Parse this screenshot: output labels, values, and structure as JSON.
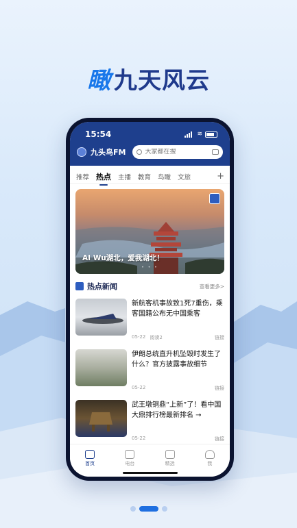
{
  "headline": {
    "accent": "瞰",
    "text": "九天风云"
  },
  "status": {
    "time": "15:54"
  },
  "app": {
    "name": "九头鸟FM"
  },
  "search": {
    "placeholder": "大家都在搜"
  },
  "tabs": [
    {
      "label": "推荐"
    },
    {
      "label": "热点"
    },
    {
      "label": "主播"
    },
    {
      "label": "教育"
    },
    {
      "label": "鸟瞰"
    },
    {
      "label": "文旅"
    }
  ],
  "tab_add": "+",
  "banner": {
    "caption": "AI Wu湖北，爱我湖北！"
  },
  "section": {
    "title": "热点新闻",
    "more": "查看更多>"
  },
  "news": [
    {
      "title": "新航客机事故致1死7重伤，乘客国籍公布无中国乘客",
      "date": "05-22",
      "reads": "阅读2",
      "link": "链接"
    },
    {
      "title": "伊朗总统直升机坠毁时发生了什么？官方披露事故细节",
      "date": "05-22",
      "reads": "",
      "link": "链接"
    },
    {
      "title": "武王墩铜鼎“上新”了！看中国大鼎排行榜最新排名 →",
      "date": "05-22",
      "reads": "",
      "link": "链接"
    }
  ],
  "nav": [
    {
      "label": "首页",
      "icon": "home-icon"
    },
    {
      "label": "电台",
      "icon": "radio-icon"
    },
    {
      "label": "精选",
      "icon": "tv-icon"
    },
    {
      "label": "我",
      "icon": "person-icon"
    }
  ],
  "colors": {
    "brand": "#1e3f8d",
    "accent": "#1877ea"
  }
}
